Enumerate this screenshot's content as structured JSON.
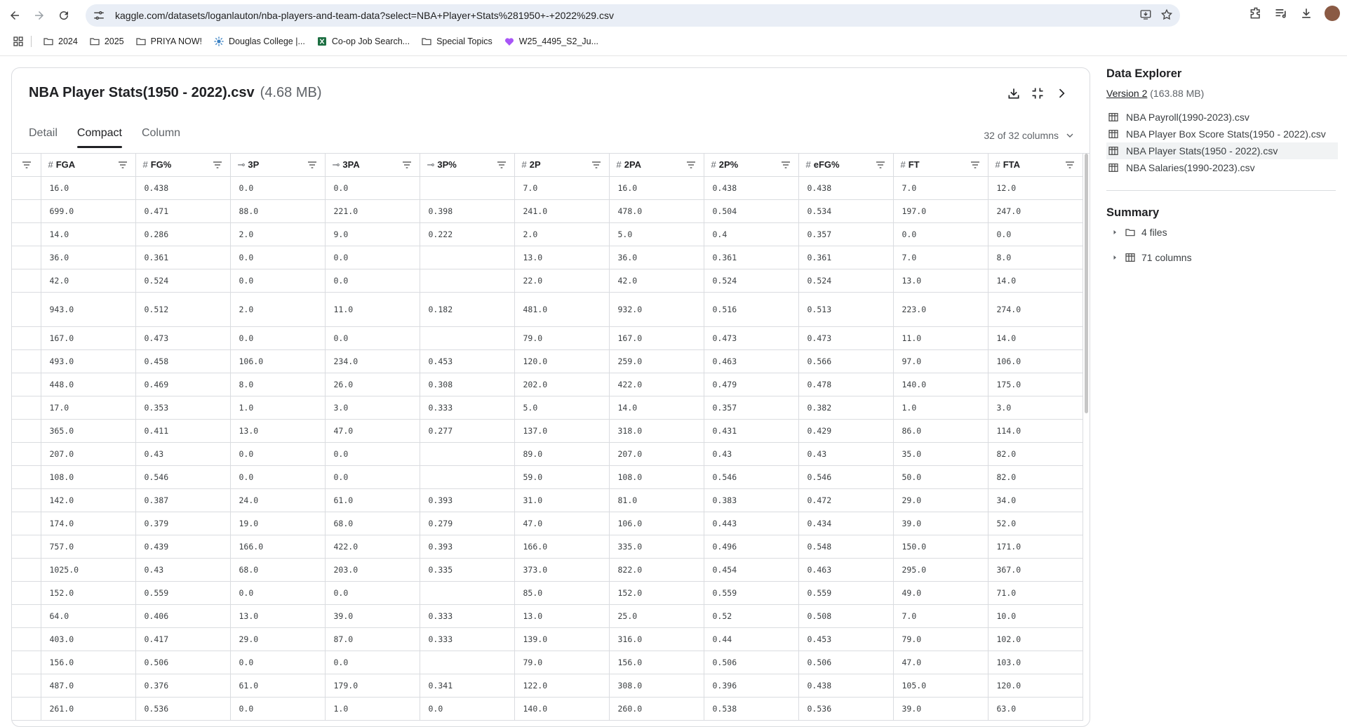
{
  "browser": {
    "url": "kaggle.com/datasets/loganlauton/nba-players-and-team-data?select=NBA+Player+Stats%281950+-+2022%29.csv",
    "bookmarks": [
      {
        "label": "2024",
        "icon": "folder-icon"
      },
      {
        "label": "2025",
        "icon": "folder-icon"
      },
      {
        "label": "PRIYA NOW!",
        "icon": "folder-icon"
      },
      {
        "label": "Douglas College |...",
        "icon": "douglas-icon"
      },
      {
        "label": "Co-op Job Search...",
        "icon": "excel-icon"
      },
      {
        "label": "Special Topics",
        "icon": "folder-icon"
      },
      {
        "label": "W25_4495_S2_Ju...",
        "icon": "heart-icon"
      }
    ]
  },
  "file": {
    "title": "NBA Player Stats(1950 - 2022).csv",
    "size": "(4.68 MB)"
  },
  "tabs": [
    "Detail",
    "Compact",
    "Column"
  ],
  "active_tab": "Compact",
  "columns_count": "32 of 32 columns",
  "table": {
    "columns": [
      {
        "type": "#",
        "name": "FGA"
      },
      {
        "type": "#",
        "name": "FG%"
      },
      {
        "type": "⊸",
        "name": "3P"
      },
      {
        "type": "⊸",
        "name": "3PA"
      },
      {
        "type": "⊸",
        "name": "3P%"
      },
      {
        "type": "#",
        "name": "2P"
      },
      {
        "type": "#",
        "name": "2PA"
      },
      {
        "type": "#",
        "name": "2P%"
      },
      {
        "type": "#",
        "name": "eFG%"
      },
      {
        "type": "#",
        "name": "FT"
      },
      {
        "type": "#",
        "name": "FTA"
      }
    ],
    "rows": [
      [
        "16.0",
        "0.438",
        "0.0",
        "0.0",
        "",
        "7.0",
        "16.0",
        "0.438",
        "0.438",
        "7.0",
        "12.0"
      ],
      [
        "699.0",
        "0.471",
        "88.0",
        "221.0",
        "0.398",
        "241.0",
        "478.0",
        "0.504",
        "0.534",
        "197.0",
        "247.0"
      ],
      [
        "14.0",
        "0.286",
        "2.0",
        "9.0",
        "0.222",
        "2.0",
        "5.0",
        "0.4",
        "0.357",
        "0.0",
        "0.0"
      ],
      [
        "36.0",
        "0.361",
        "0.0",
        "0.0",
        "",
        "13.0",
        "36.0",
        "0.361",
        "0.361",
        "7.0",
        "8.0"
      ],
      [
        "42.0",
        "0.524",
        "0.0",
        "0.0",
        "",
        "22.0",
        "42.0",
        "0.524",
        "0.524",
        "13.0",
        "14.0"
      ],
      [
        "943.0",
        "0.512",
        "2.0",
        "11.0",
        "0.182",
        "481.0",
        "932.0",
        "0.516",
        "0.513",
        "223.0",
        "274.0"
      ],
      [
        "167.0",
        "0.473",
        "0.0",
        "0.0",
        "",
        "79.0",
        "167.0",
        "0.473",
        "0.473",
        "11.0",
        "14.0"
      ],
      [
        "493.0",
        "0.458",
        "106.0",
        "234.0",
        "0.453",
        "120.0",
        "259.0",
        "0.463",
        "0.566",
        "97.0",
        "106.0"
      ],
      [
        "448.0",
        "0.469",
        "8.0",
        "26.0",
        "0.308",
        "202.0",
        "422.0",
        "0.479",
        "0.478",
        "140.0",
        "175.0"
      ],
      [
        "17.0",
        "0.353",
        "1.0",
        "3.0",
        "0.333",
        "5.0",
        "14.0",
        "0.357",
        "0.382",
        "1.0",
        "3.0"
      ],
      [
        "365.0",
        "0.411",
        "13.0",
        "47.0",
        "0.277",
        "137.0",
        "318.0",
        "0.431",
        "0.429",
        "86.0",
        "114.0"
      ],
      [
        "207.0",
        "0.43",
        "0.0",
        "0.0",
        "",
        "89.0",
        "207.0",
        "0.43",
        "0.43",
        "35.0",
        "82.0"
      ],
      [
        "108.0",
        "0.546",
        "0.0",
        "0.0",
        "",
        "59.0",
        "108.0",
        "0.546",
        "0.546",
        "50.0",
        "82.0"
      ],
      [
        "142.0",
        "0.387",
        "24.0",
        "61.0",
        "0.393",
        "31.0",
        "81.0",
        "0.383",
        "0.472",
        "29.0",
        "34.0"
      ],
      [
        "174.0",
        "0.379",
        "19.0",
        "68.0",
        "0.279",
        "47.0",
        "106.0",
        "0.443",
        "0.434",
        "39.0",
        "52.0"
      ],
      [
        "757.0",
        "0.439",
        "166.0",
        "422.0",
        "0.393",
        "166.0",
        "335.0",
        "0.496",
        "0.548",
        "150.0",
        "171.0"
      ],
      [
        "1025.0",
        "0.43",
        "68.0",
        "203.0",
        "0.335",
        "373.0",
        "822.0",
        "0.454",
        "0.463",
        "295.0",
        "367.0"
      ],
      [
        "152.0",
        "0.559",
        "0.0",
        "0.0",
        "",
        "85.0",
        "152.0",
        "0.559",
        "0.559",
        "49.0",
        "71.0"
      ],
      [
        "64.0",
        "0.406",
        "13.0",
        "39.0",
        "0.333",
        "13.0",
        "25.0",
        "0.52",
        "0.508",
        "7.0",
        "10.0"
      ],
      [
        "403.0",
        "0.417",
        "29.0",
        "87.0",
        "0.333",
        "139.0",
        "316.0",
        "0.44",
        "0.453",
        "79.0",
        "102.0"
      ],
      [
        "156.0",
        "0.506",
        "0.0",
        "0.0",
        "",
        "79.0",
        "156.0",
        "0.506",
        "0.506",
        "47.0",
        "103.0"
      ],
      [
        "487.0",
        "0.376",
        "61.0",
        "179.0",
        "0.341",
        "122.0",
        "308.0",
        "0.396",
        "0.438",
        "105.0",
        "120.0"
      ],
      [
        "261.0",
        "0.536",
        "0.0",
        "1.0",
        "0.0",
        "140.0",
        "260.0",
        "0.538",
        "0.536",
        "39.0",
        "63.0"
      ]
    ]
  },
  "explorer": {
    "title": "Data Explorer",
    "version_label": "Version 2",
    "version_size": "(163.88 MB)",
    "files": [
      "NBA Payroll(1990-2023).csv",
      "NBA Player Box Score Stats(1950 - 2022).csv",
      "NBA Player Stats(1950 - 2022).csv",
      "NBA Salaries(1990-2023).csv"
    ],
    "selected_file": "NBA Player Stats(1950 - 2022).csv",
    "summary_title": "Summary",
    "summary_items": [
      "4 files",
      "71 columns"
    ]
  }
}
